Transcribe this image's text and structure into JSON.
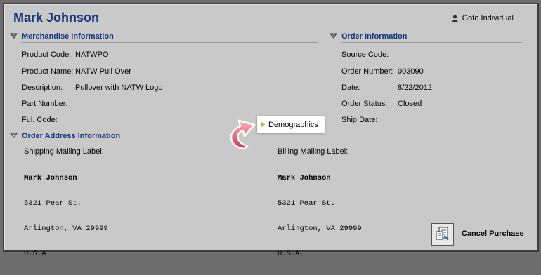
{
  "header": {
    "title": "Mark Johnson",
    "goto_label": "Goto Individual"
  },
  "merchandise": {
    "heading": "Merchandise Information",
    "rows": [
      {
        "label": "Product Code:",
        "value": "NATWPO"
      },
      {
        "label": "Product Name:",
        "value": "NATW Pull Over"
      },
      {
        "label": "Description:",
        "value": "Pullover with NATW Logo"
      },
      {
        "label": "Part Number:",
        "value": ""
      },
      {
        "label": "Ful. Code:",
        "value": ""
      }
    ]
  },
  "order": {
    "heading": "Order Information",
    "rows": [
      {
        "label": "Source Code:",
        "value": ""
      },
      {
        "label": "Order Number:",
        "value": "003090"
      },
      {
        "label": "Date:",
        "value": "8/22/2012"
      },
      {
        "label": "Order Status:",
        "value": "Closed"
      },
      {
        "label": "Ship Date:",
        "value": ""
      }
    ]
  },
  "popup": {
    "label": "Demographics"
  },
  "address": {
    "heading": "Order Address Information",
    "shipping": {
      "label": "Shipping Mailing Label:",
      "name": "Mark Johnson",
      "line1": "5321 Pear St.",
      "line2": "Arlington, VA 29999",
      "line3": "U.S.A."
    },
    "billing": {
      "label": "Billing Mailing Label:",
      "name": "Mark Johnson",
      "line1": "5321 Pear St.",
      "line2": "Arlington, VA 29999",
      "line3": "U.S.A."
    }
  },
  "footer": {
    "cancel_label": "Cancel Purchase"
  },
  "colors": {
    "heading": "#12357a",
    "background": "#c9c9c9",
    "frame": "#3c3c3c"
  },
  "icons": {
    "goto": "person-icon",
    "section": "collapse-icon",
    "cancel": "document-icon"
  }
}
